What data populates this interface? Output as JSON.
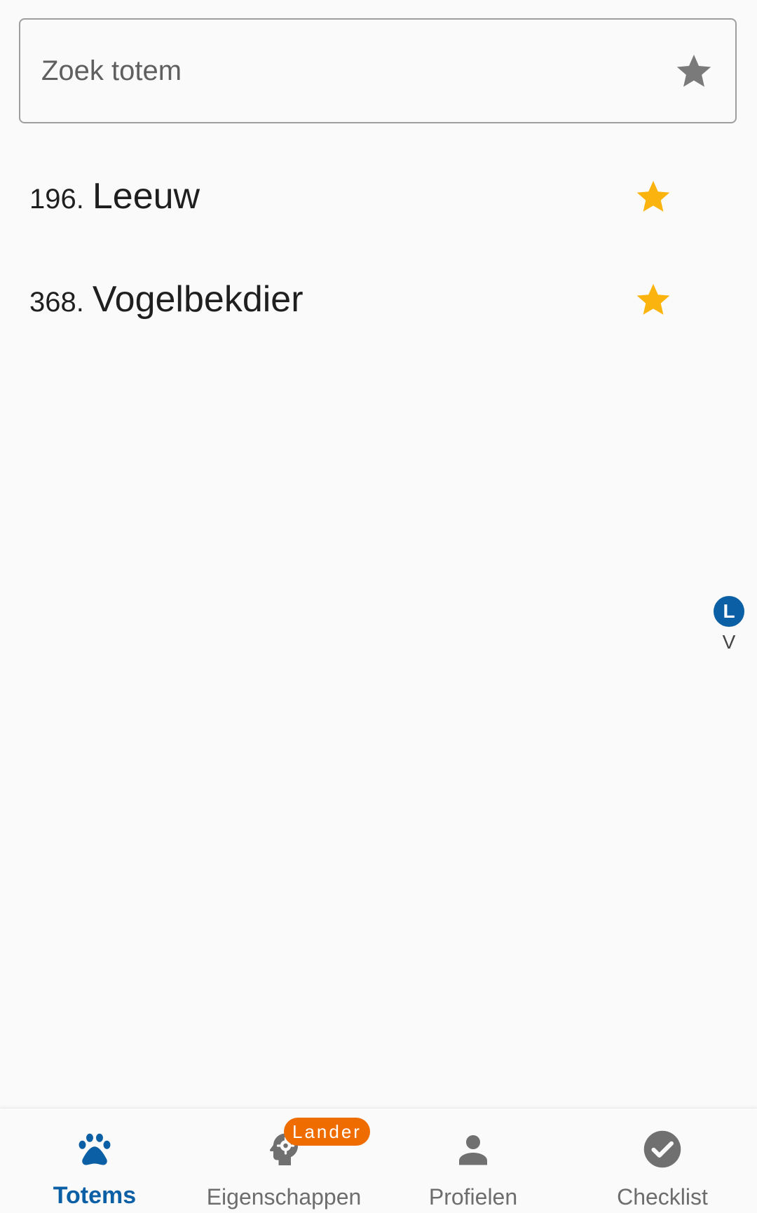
{
  "search": {
    "placeholder": "Zoek totem",
    "star_icon": "star-outline-grey"
  },
  "totems": [
    {
      "number": "196.",
      "name": "Leeuw",
      "favorite": true
    },
    {
      "number": "368.",
      "name": "Vogelbekdier",
      "favorite": true
    }
  ],
  "alphabet_index": {
    "active": "L",
    "letters": [
      "V"
    ]
  },
  "bottom_nav": {
    "items": [
      {
        "label": "Totems",
        "icon": "paw-icon",
        "active": true
      },
      {
        "label": "Eigenschappen",
        "icon": "head-gear-icon",
        "active": false
      },
      {
        "label": "Profielen",
        "icon": "person-icon",
        "active": false,
        "badge": "Lander"
      },
      {
        "label": "Checklist",
        "icon": "check-circle-icon",
        "active": false
      }
    ]
  },
  "colors": {
    "accent": "#0b5fa5",
    "favorite_star": "#fbb40f",
    "badge": "#ef6c00",
    "inactive": "#6d6d6d"
  }
}
